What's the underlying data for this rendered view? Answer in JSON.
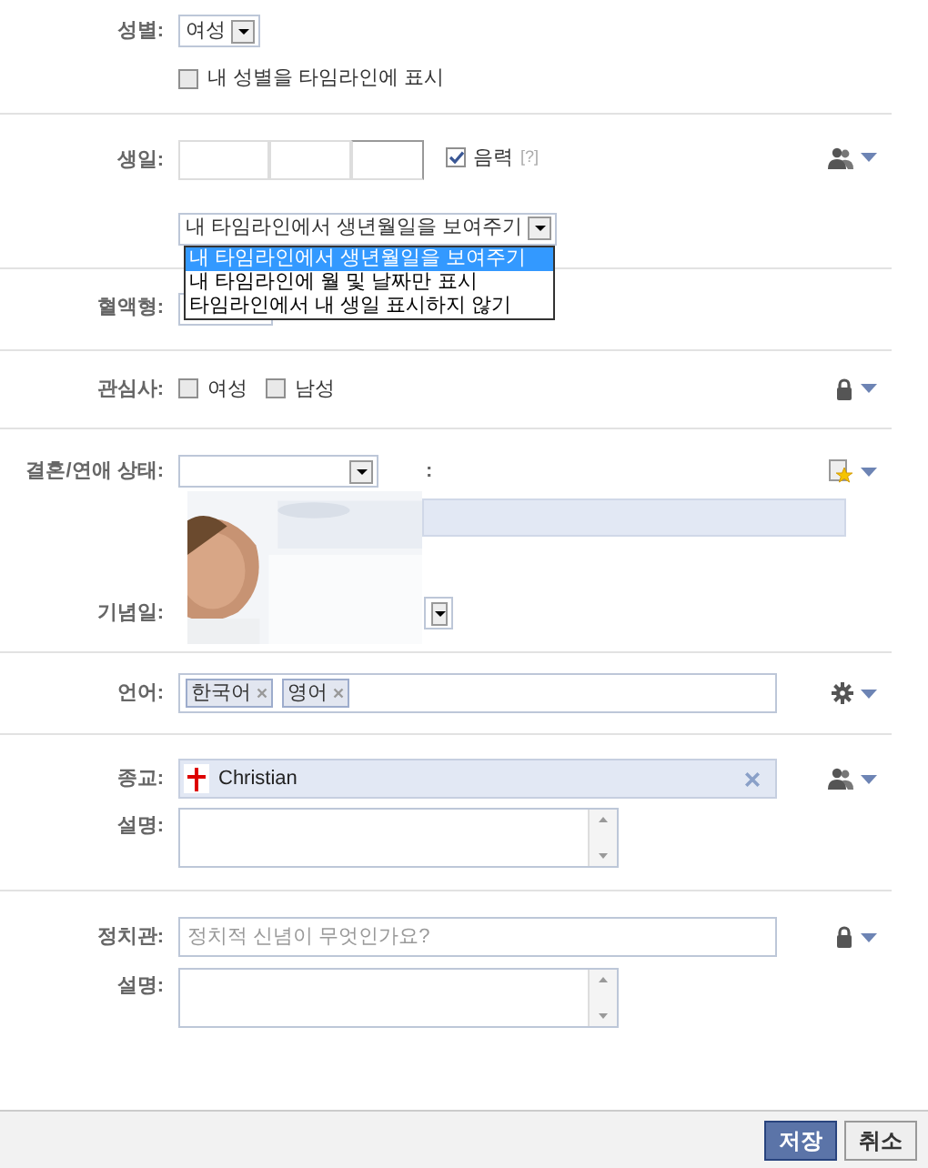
{
  "gender": {
    "label": "성별:",
    "value": "여성",
    "show_on_timeline": {
      "label": "내 성별을 타임라인에 표시",
      "checked": false
    }
  },
  "birthday": {
    "label": "생일:",
    "lunar": {
      "label": "음력",
      "checked": true
    },
    "help": "[?]",
    "privacy_icon": {
      "kind": "friends"
    },
    "visibility": {
      "value": "내 타임라인에서 생년월일을 보여주기",
      "expanded": true,
      "options": [
        {
          "label": "내 타임라인에서 생년월일을 보여주기",
          "selected": true
        },
        {
          "label": "내 타임라인에 월 및 날짜만 표시",
          "selected": false
        },
        {
          "label": "타임라인에서 내 생일 표시하지 않기",
          "selected": false
        }
      ]
    }
  },
  "blood_type": {
    "label": "혈액형:"
  },
  "interested_in": {
    "label": "관심사:",
    "privacy_icon": {
      "kind": "only_me"
    },
    "options": [
      {
        "label": "여성",
        "checked": false
      },
      {
        "label": "남성",
        "checked": false
      }
    ]
  },
  "relationship": {
    "label": "결혼/연애 상태:",
    "partner_label": ":",
    "privacy_icon": {
      "kind": "custom"
    },
    "anniversary_label": "기념일:"
  },
  "languages": {
    "label": "언어:",
    "privacy_icon": {
      "kind": "settings"
    },
    "tokens": [
      "한국어",
      "영어"
    ]
  },
  "religion": {
    "label": "종교:",
    "value": "Christian",
    "privacy_icon": {
      "kind": "friends"
    },
    "description_label": "설명:"
  },
  "political": {
    "label": "정치관:",
    "placeholder": "정치적 신념이 무엇인가요?",
    "privacy_icon": {
      "kind": "only_me"
    },
    "description_label": "설명:"
  },
  "buttons": [
    {
      "label": "저장",
      "kind": "primary"
    },
    {
      "label": "취소",
      "kind": "secondary"
    }
  ]
}
